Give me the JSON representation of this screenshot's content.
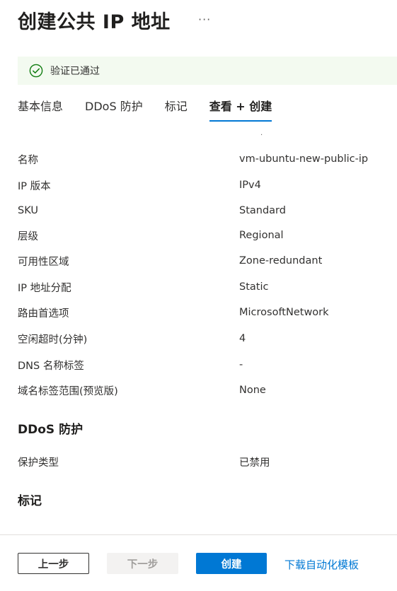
{
  "header": {
    "title": "创建公共 IP 地址",
    "more": "···"
  },
  "validation": {
    "text": "验证已通过",
    "color": "#107c10"
  },
  "tabs": [
    {
      "label": "基本信息",
      "active": false
    },
    {
      "label": "DDoS 防护",
      "active": false
    },
    {
      "label": "标记",
      "active": false
    },
    {
      "label": "查看 + 创建",
      "active": true
    }
  ],
  "scroll_hint": "·",
  "details": [
    {
      "label": "名称",
      "value": "vm-ubuntu-new-public-ip"
    },
    {
      "label": "IP 版本",
      "value": "IPv4"
    },
    {
      "label": "SKU",
      "value": "Standard"
    },
    {
      "label": "层级",
      "value": "Regional"
    },
    {
      "label": "可用性区域",
      "value": "Zone-redundant"
    },
    {
      "label": "IP 地址分配",
      "value": "Static"
    },
    {
      "label": "路由首选项",
      "value": "MicrosoftNetwork"
    },
    {
      "label": "空闲超时(分钟)",
      "value": "4"
    },
    {
      "label": "DNS 名称标签",
      "value": "-"
    },
    {
      "label": "域名标签范围(预览版)",
      "value": "None"
    }
  ],
  "ddos": {
    "heading": "DDoS 防护",
    "rows": [
      {
        "label": "保护类型",
        "value": "已禁用"
      }
    ]
  },
  "tags": {
    "heading": "标记"
  },
  "footer": {
    "prev_label": "上一步",
    "next_label": "下一步",
    "create_label": "创建",
    "template_link": "下载自动化模板"
  },
  "colors": {
    "accent": "#0078d4",
    "success_bg": "#f3faf0"
  }
}
